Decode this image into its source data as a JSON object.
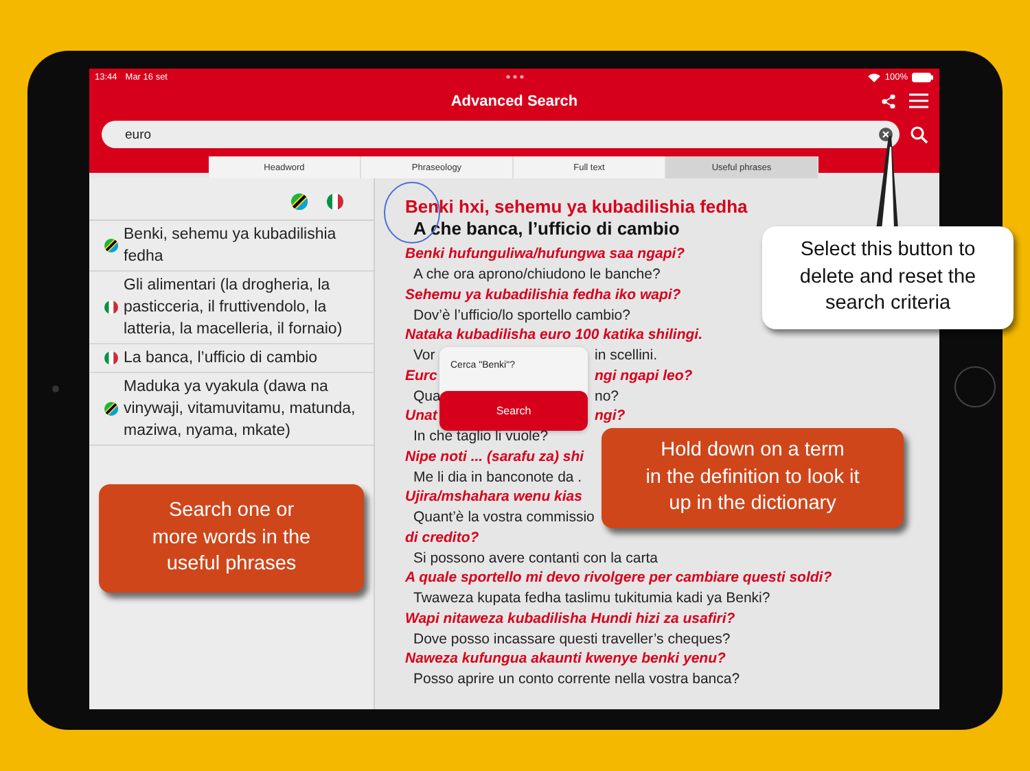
{
  "status_bar": {
    "time": "13:44",
    "date": "Mar 16 set",
    "battery": "100%"
  },
  "title": "Advanced Search",
  "search": {
    "value": "euro"
  },
  "tabs": [
    {
      "label": "Headword",
      "selected": false
    },
    {
      "label": "Phraseology",
      "selected": false
    },
    {
      "label": "Full text",
      "selected": false
    },
    {
      "label": "Useful phrases",
      "selected": true
    }
  ],
  "results": [
    {
      "kind": "sw",
      "text": "Benki, sehemu ya kubadilishia fedha"
    },
    {
      "kind": "it",
      "text": "Gli alimentari (la drogheria, la pasticceria, il fruttivendolo, la latteria, la macelleria, il fornaio)"
    },
    {
      "kind": "it",
      "text": "La banca, l’ufficio di cambio"
    },
    {
      "kind": "sw",
      "text": "Maduka ya vyakula (dawa na vinywaji, vitamuvitamu, matunda, maziwa, nyama, mkate)"
    }
  ],
  "phrasebook": {
    "heading": {
      "source": "Benki hxi, sehemu ya kubadilishia fedha",
      "target": "A che banca, l’ufficio di cambio"
    },
    "entries": [
      {
        "source": [
          "Benki hufunguliwa/hufungwa saa ngapi?"
        ],
        "target": [
          "A che ora aprono/chiudono le banche?"
        ]
      },
      {
        "source": [
          "Sehemu ya kubadilishia fedha iko wapi?"
        ],
        "target": [
          "Dov’è l’ufficio/lo sportello cambio?"
        ]
      },
      {
        "source": [
          "Nataka kubadilisha euro 100 katika shilingi."
        ],
        "target": [
          "Vor",
          "in scellini."
        ]
      },
      {
        "source": [
          "Eurc",
          "ngi ngapi leo?"
        ],
        "target": [
          "Qua",
          "no?"
        ]
      },
      {
        "source": [
          "Unat",
          "ngi?"
        ],
        "target": [
          "In che taglio li vuole?"
        ]
      },
      {
        "source": [
          "Nipe noti ... (sarafu za) shi"
        ],
        "target": [
          "Me li dia in banconote da ."
        ]
      },
      {
        "source": [
          "Ujira/mshahara wenu kias"
        ],
        "target": [
          "Quant’è la vostra commissio"
        ]
      },
      {
        "source": [
          "di credito?"
        ],
        "target": [
          "Si possono avere contanti con la carta"
        ]
      },
      {
        "source": [
          "A quale sportello mi devo rivolgere per cambiare questi soldi?"
        ],
        "target": [
          "Twaweza kupata fedha taslimu tukitumia kadi ya Benki?"
        ]
      },
      {
        "source": [
          "Wapi nitaweza kubadilisha Hundi hizi za usafiri?"
        ],
        "target": [
          "Dove posso incassare questi traveller’s cheques?"
        ]
      },
      {
        "source": [
          "Naweza kufungua akaunti kwenye benki yenu?"
        ],
        "target": [
          "Posso aprire un conto corrente nella vostra banca?"
        ]
      }
    ]
  },
  "popup": {
    "prompt": "Cerca \"Benki\"?",
    "button": "Search"
  },
  "callouts": [
    {
      "kind": "bubble",
      "text": "Select this button to\ndelete and reset the\nsearch criteria"
    },
    {
      "kind": "note",
      "text": "Hold down on a term\nin the definition to look it\nup in the dictionary"
    },
    {
      "kind": "note",
      "text": "Search one or\nmore words in the\nuseful phrases"
    }
  ]
}
